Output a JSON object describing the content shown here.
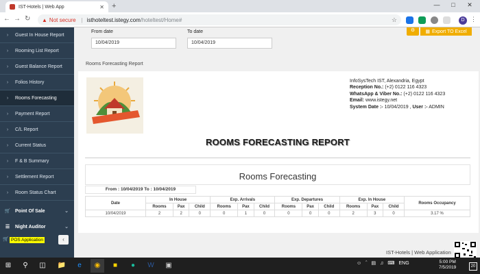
{
  "browser": {
    "tab_title": "IST-Hotels | Web App",
    "tab_close": "✕",
    "new_tab": "+",
    "security_label": "Not secure",
    "url_host": "isthoteltest.istegy.com",
    "url_path": "/hoteltest/Home#",
    "profile_initial": "D"
  },
  "sidebar": {
    "items": [
      {
        "label": "Guest In House Report"
      },
      {
        "label": "Rooming List Report"
      },
      {
        "label": "Guest Balance Report"
      },
      {
        "label": "Folios History"
      },
      {
        "label": "Rooms Forecasting"
      },
      {
        "label": "Payment Report"
      },
      {
        "label": "C/L Report"
      },
      {
        "label": "Current Status"
      },
      {
        "label": "F & B Summary"
      },
      {
        "label": "Settlement Report"
      },
      {
        "label": "Room Status Chart"
      }
    ],
    "groups": [
      {
        "label": "Point Of Sale"
      },
      {
        "label": "Night Auditor"
      }
    ],
    "pos_application": "POS Application"
  },
  "filters": {
    "from_label": "From date",
    "from_value": "10/04/2019",
    "to_label": "To date",
    "to_value": "10/04/2019",
    "export_label": "Export TO Excel"
  },
  "breadcrumb": "Rooms Forecasting Report",
  "company": {
    "line1": "InfoSysTech IST, Alexandria, Egypt",
    "reception_label": "Reception No.:",
    "reception_value": " (+2) 0122 116 4323",
    "whatsapp_label": "WhatsApp & Viber No.:",
    "whatsapp_value": " (+2) 0122 116 4323",
    "email_label": "Email:",
    "email_value": " www.istegy.net",
    "sysdate_label": "System Date :-",
    "sysdate_value": " 10/04/2019 , ",
    "user_label": "User :-",
    "user_value": " ADMIN"
  },
  "report": {
    "title": "ROOMS FORECASTING REPORT",
    "panel_title": "Rooms Forecasting",
    "range": "From : 10/04/2019 To : 10/04/2019",
    "group_headers": [
      "In House",
      "Exp. Arrivals",
      "Exp. Departures",
      "Exp. In House"
    ],
    "date_header": "Date",
    "sub_headers": [
      "Rooms",
      "Pax",
      "Child",
      "Rooms",
      "Pax",
      "Child",
      "Rooms",
      "Pax",
      "Child",
      "Rooms",
      "Pax",
      "Child"
    ],
    "occupancy_header": "Rooms Occupancy",
    "rows": [
      {
        "date": "10/04/2019",
        "cells": [
          "2",
          "2",
          "0",
          "0",
          "1",
          "0",
          "0",
          "0",
          "0",
          "2",
          "3",
          "0"
        ],
        "occupancy": "3.17 %"
      }
    ]
  },
  "footer": {
    "watermark": "IST-Hotels | Web Application"
  },
  "taskbar": {
    "language": "ENG",
    "time": "5:00 PM",
    "date": "7/5/2019",
    "notifications": "20"
  }
}
